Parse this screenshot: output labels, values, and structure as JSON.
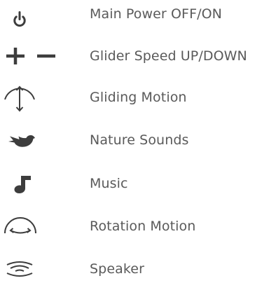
{
  "legend": {
    "items": [
      {
        "icon": "power-icon",
        "label": "Main Power OFF/ON"
      },
      {
        "icon": "plus-minus-icon",
        "label": "Glider Speed UP/DOWN"
      },
      {
        "icon": "gliding-motion-icon",
        "label": "Gliding Motion"
      },
      {
        "icon": "bird-icon",
        "label": "Nature Sounds"
      },
      {
        "icon": "music-note-icon",
        "label": "Music"
      },
      {
        "icon": "rotation-motion-icon",
        "label": "Rotation Motion"
      },
      {
        "icon": "speaker-icon",
        "label": "Speaker"
      }
    ]
  },
  "colors": {
    "text": "#5a5a5a",
    "icon": "#3d3d3d"
  }
}
